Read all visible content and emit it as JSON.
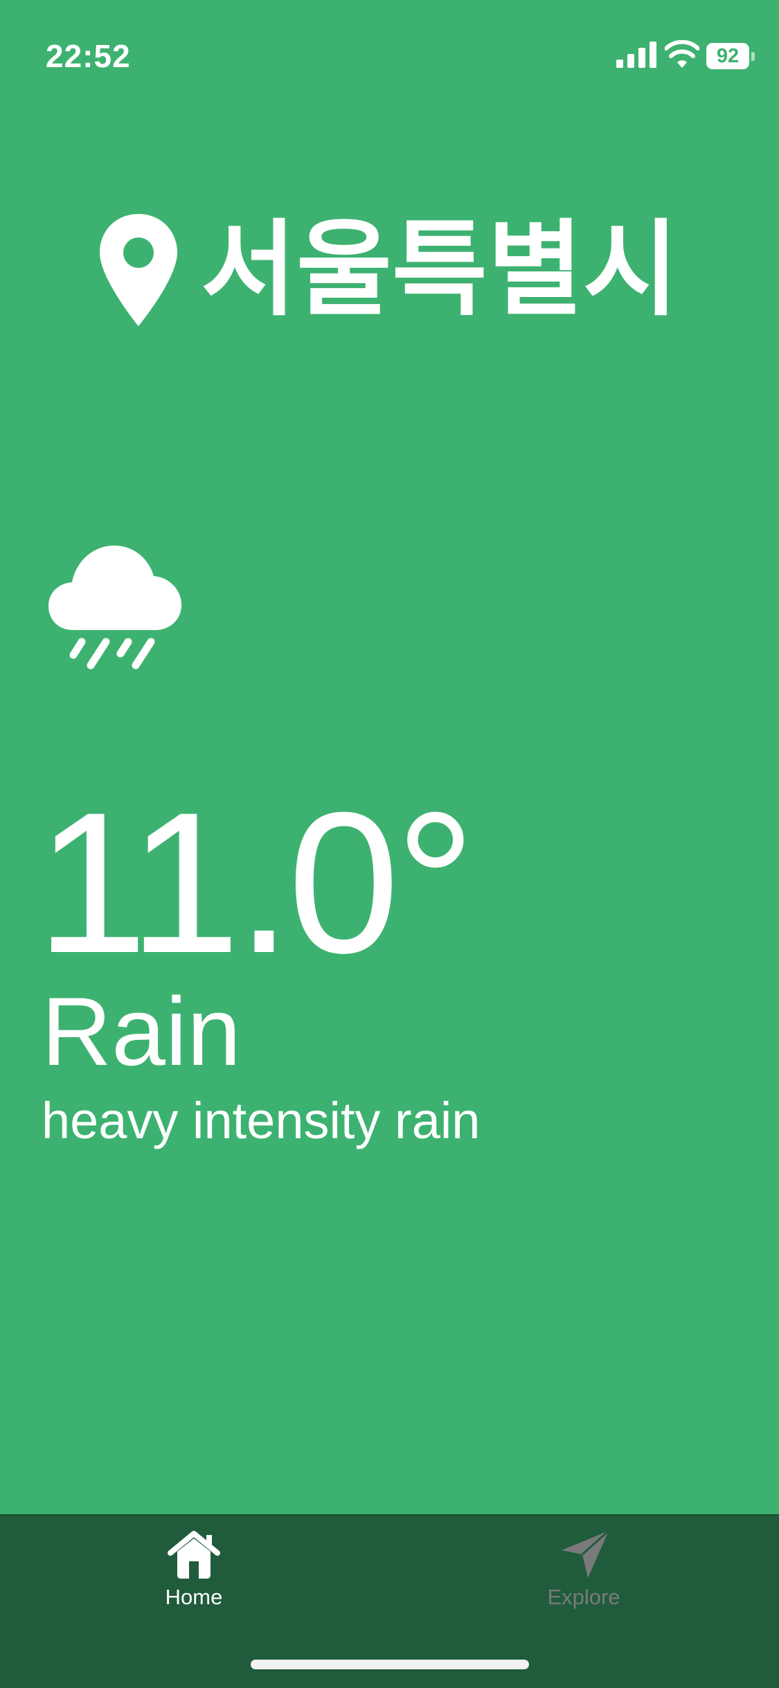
{
  "status_bar": {
    "time": "22:52",
    "battery": "92"
  },
  "location": {
    "icon": "map-pin-icon",
    "city": "서울특별시"
  },
  "weather": {
    "icon": "cloud-rain-icon",
    "temperature": "11.0°",
    "condition": "Rain",
    "description": "heavy intensity rain"
  },
  "tab_bar": {
    "tabs": [
      {
        "label": "Home",
        "icon": "home-icon",
        "active": true
      },
      {
        "label": "Explore",
        "icon": "paper-plane-icon",
        "active": false
      }
    ]
  },
  "colors": {
    "background": "#3db270",
    "tab_bar": "#205c3b",
    "text": "#ffffff",
    "inactive_tab": "#7a7a7a"
  }
}
